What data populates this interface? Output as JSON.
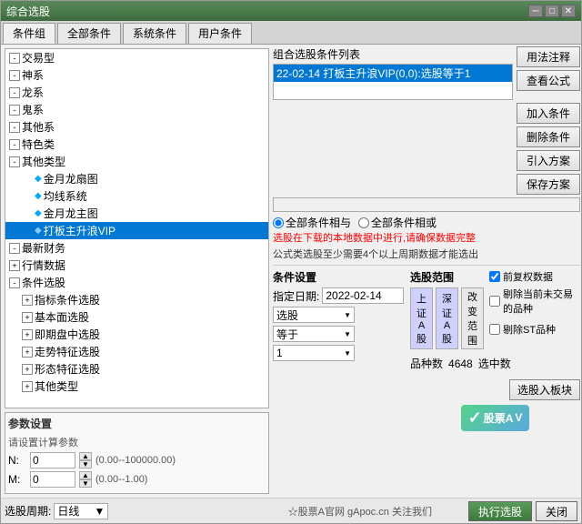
{
  "window": {
    "title": "综合选股",
    "close_btn": "✕",
    "min_btn": "─",
    "max_btn": "□"
  },
  "tabs": [
    {
      "label": "条件组",
      "active": true
    },
    {
      "label": "全部条件"
    },
    {
      "label": "系统条件"
    },
    {
      "label": "用户条件"
    }
  ],
  "tree": {
    "items": [
      {
        "label": "交易型",
        "indent": 1,
        "expanded": true,
        "has_expand": true
      },
      {
        "label": "神系",
        "indent": 1,
        "expanded": true,
        "has_expand": true
      },
      {
        "label": "龙系",
        "indent": 1,
        "expanded": true,
        "has_expand": true
      },
      {
        "label": "鬼系",
        "indent": 1,
        "expanded": true,
        "has_expand": true
      },
      {
        "label": "其他系",
        "indent": 1,
        "expanded": true,
        "has_expand": true
      },
      {
        "label": "特色类",
        "indent": 1,
        "expanded": true,
        "has_expand": true
      },
      {
        "label": "其他类型",
        "indent": 1,
        "expanded": true,
        "has_expand": true
      },
      {
        "label": "金月龙扇图",
        "indent": 2,
        "diamond": true
      },
      {
        "label": "均线系统",
        "indent": 2,
        "diamond": true
      },
      {
        "label": "金月龙主图",
        "indent": 2,
        "diamond": true
      },
      {
        "label": "打板主升浪VIP",
        "indent": 2,
        "diamond": true,
        "selected": true
      },
      {
        "label": "最新财务",
        "indent": 0,
        "expanded": true,
        "has_expand": true
      },
      {
        "label": "行情数据",
        "indent": 0,
        "expanded": false,
        "has_expand": true
      },
      {
        "label": "条件选股",
        "indent": 0,
        "expanded": true,
        "has_expand": true
      },
      {
        "label": "指标条件选股",
        "indent": 1,
        "expanded": false,
        "has_expand": true
      },
      {
        "label": "基本面选股",
        "indent": 1,
        "expanded": false,
        "has_expand": true
      },
      {
        "label": "即期盘中选股",
        "indent": 1,
        "expanded": false,
        "has_expand": true
      },
      {
        "label": "走势特征选股",
        "indent": 1,
        "expanded": false,
        "has_expand": true
      },
      {
        "label": "形态特征选股",
        "indent": 1,
        "expanded": false,
        "has_expand": true
      },
      {
        "label": "其他类型",
        "indent": 1,
        "expanded": false,
        "has_expand": true
      }
    ]
  },
  "params": {
    "title": "参数设置",
    "label_n": "N:",
    "label_m": "M:",
    "n_value": "0",
    "m_value": "0",
    "n_range": "(0.00--100000.00)",
    "m_range": "(0.00--1.00)",
    "subtitle": "请设置计算参数"
  },
  "condition_group": {
    "label": "组合选股条件列表",
    "items": [
      {
        "label": "22-02-14 打板主升浪VIP(0,0):选股等于1",
        "selected": true
      }
    ]
  },
  "buttons": {
    "usage_note": "用法注释",
    "view_formula": "查看公式",
    "add_condition": "加入条件",
    "delete_condition": "删除条件",
    "import_plan": "引入方案",
    "save_plan": "保存方案"
  },
  "radio_options": {
    "option1": "全部条件相与",
    "option2": "全部条件相或"
  },
  "warning": "选股在下载的本地数据中进行,请确保数据完整",
  "info": "公式类选股至少需要4个以上周期数据才能选出",
  "condition_settings": {
    "title": "条件设置",
    "date_label": "指定日期:",
    "date_value": "2022-02-14",
    "dropdown1": "选股",
    "dropdown2": "等于",
    "dropdown3": "1"
  },
  "stock_range": {
    "title": "选股范围",
    "sh_a": "上证A股",
    "sz_a": "深证A股",
    "change_range": "改变范围"
  },
  "options": {
    "pre_rights": "前复权数据",
    "remove_st": "剔除当前未交易的品种",
    "remove_st2": "剔除ST品种"
  },
  "counts": {
    "total_label": "品种数",
    "total_value": "4648",
    "selected_label": "选中数",
    "selected_value": ""
  },
  "period": {
    "label": "选股周期:",
    "value": "日线"
  },
  "bottom_buttons": {
    "execute": "执行选股",
    "close": "关闭"
  },
  "watermark": {
    "text": "股票A",
    "sub": "V"
  }
}
